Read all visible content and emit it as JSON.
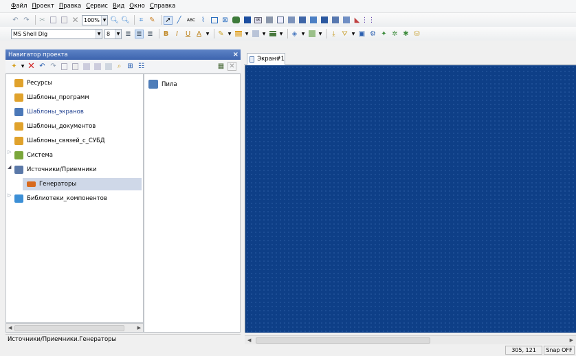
{
  "menu": [
    {
      "first": "Ф",
      "rest": "айл"
    },
    {
      "first": "П",
      "rest": "роект"
    },
    {
      "first": "П",
      "rest": "равка"
    },
    {
      "first": "С",
      "rest": "ервис"
    },
    {
      "first": "В",
      "rest": "ид"
    },
    {
      "first": "О",
      "rest": "кно"
    },
    {
      "first": "С",
      "rest": "правка"
    }
  ],
  "toolbar": {
    "zoom": "100%",
    "font": "MS Shell Dlg",
    "font_size": "8",
    "abc_label": "ABC",
    "bold": "B",
    "italic": "I",
    "underline": "U",
    "text_color": "A"
  },
  "navigator": {
    "title": "Навигатор проекта",
    "close": "×",
    "tree": [
      {
        "label": "Ресурсы",
        "color": "#e0a22c"
      },
      {
        "label": "Шаблоны_программ",
        "color": "#e0a22c"
      },
      {
        "label": "Шаблоны_экранов",
        "color": "#4b78b8",
        "highlight": true
      },
      {
        "label": "Шаблоны_документов",
        "color": "#e0a22c"
      },
      {
        "label": "Шаблоны_связей_с_СУБД",
        "color": "#e0a22c"
      },
      {
        "label": "Система",
        "color": "#7aa63b"
      },
      {
        "label": "Источники/Приемники",
        "color": "#5a78a8"
      },
      {
        "label": "Генераторы",
        "color": "#d86a1e"
      },
      {
        "label": "Библиотеки_компонентов",
        "color": "#3c8fd6"
      }
    ],
    "list_item": "Пила",
    "status_path": "Источники/Приемники.Генераторы"
  },
  "editor": {
    "tab_label": "Экран#1",
    "canvas_color": "#0e3f87"
  },
  "status": {
    "coords": "305, 121",
    "snap": "Snap OFF"
  }
}
